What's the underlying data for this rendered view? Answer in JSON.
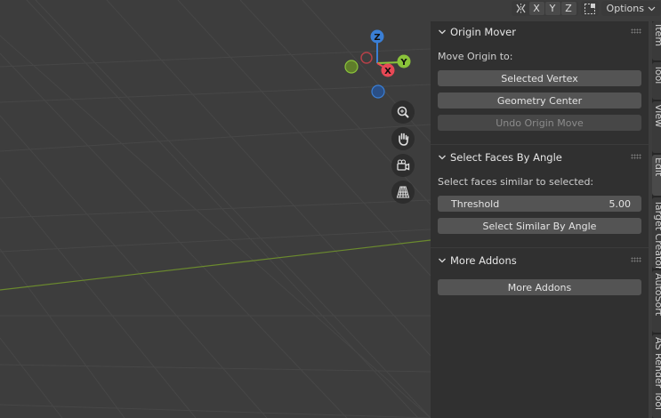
{
  "header": {
    "axes": [
      "X",
      "Y",
      "Z"
    ],
    "options_label": "Options",
    "icons": [
      "mirror-icon",
      "snap-icon",
      "chevron-down-icon"
    ]
  },
  "gizmo": {
    "z_label": "Z",
    "y_label": "Y",
    "x_label": "X",
    "colors": {
      "x": "#e84855",
      "y": "#8ac33a",
      "z": "#3a7fd6"
    }
  },
  "navigation": {
    "icons": [
      "zoom-icon",
      "pan-hand-icon",
      "camera-icon",
      "perspective-grid-icon"
    ]
  },
  "panels": {
    "origin_mover": {
      "title": "Origin Mover",
      "label": "Move Origin to:",
      "selected_vertex": "Selected Vertex",
      "geometry_center": "Geometry Center",
      "undo": "Undo Origin Move"
    },
    "select_faces": {
      "title": "Select Faces By Angle",
      "label": "Select faces similar to selected:",
      "threshold_label": "Threshold",
      "threshold_value": "5.00",
      "select_button": "Select Similar By Angle"
    },
    "more_addons": {
      "title": "More Addons",
      "button": "More Addons"
    }
  },
  "tabs": [
    "Item",
    "Tool",
    "View",
    "Edit",
    "Target Creator",
    "AutoSort",
    "AS Render Tool"
  ],
  "colors": {
    "viewport_bg": "#3d3d3d",
    "panel_bg": "#303030",
    "button_bg": "#545454",
    "grid_line": "#474747",
    "x_axis_line": "#6b8a2e"
  }
}
